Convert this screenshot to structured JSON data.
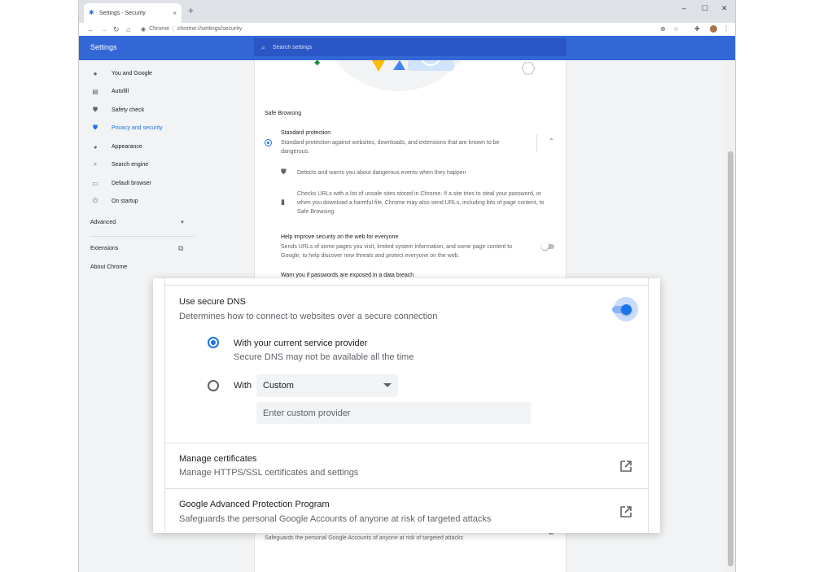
{
  "browser": {
    "tab_title": "Settings - Security",
    "tab_close": "×",
    "new_tab": "+",
    "win_min": "–",
    "win_max": "☐",
    "win_close": "✕",
    "omnibox_chip": "Chrome",
    "omnibox_url": "chrome://settings/security",
    "nav_back": "←",
    "nav_forward": "→",
    "nav_reload": "↻",
    "nav_home": "⌂"
  },
  "header": {
    "title": "Settings",
    "search_placeholder": "Search settings"
  },
  "sidebar": {
    "items": [
      {
        "label": "You and Google",
        "icon": "person-icon",
        "glyph": "●"
      },
      {
        "label": "Autofill",
        "icon": "clipboard-icon",
        "glyph": "▤"
      },
      {
        "label": "Safety check",
        "icon": "shield-check-icon",
        "glyph": "⛊"
      },
      {
        "label": "Privacy and security",
        "icon": "shield-icon",
        "glyph": "⛊"
      },
      {
        "label": "Appearance",
        "icon": "palette-icon",
        "glyph": "◕"
      },
      {
        "label": "Search engine",
        "icon": "search-icon",
        "glyph": "⌕"
      },
      {
        "label": "Default browser",
        "icon": "browser-icon",
        "glyph": "▭"
      },
      {
        "label": "On startup",
        "icon": "power-icon",
        "glyph": "⏻"
      }
    ],
    "advanced": "Advanced",
    "extensions": "Extensions",
    "about": "About Chrome"
  },
  "security": {
    "safe_browsing_label": "Safe Browsing",
    "standard": {
      "title": "Standard protection",
      "desc_line1": "Standard protection against websites, downloads, and extensions that are known to be",
      "desc_line2": "dangerous."
    },
    "detail1": "Detects and warns you about dangerous events when they happen",
    "detail2_lines": [
      "Checks URLs with a list of unsafe sites stored in Chrome. If a site tries to steal your password, or",
      "when you download a harmful file, Chrome may also send URLs, including bits of page content, to",
      "Safe Browsing."
    ],
    "help_improve": {
      "title": "Help improve security on the web for everyone",
      "desc_line1": "Sends URLs of some pages you visit, limited system information, and some page content to",
      "desc_line2": "Google, to help discover new threats and protect everyone on the web."
    },
    "warn_passwords": "Warn you if passwords are exposed in a data breach",
    "gapp_bottom_desc": "Safeguards the personal Google Accounts of anyone at risk of targeted attacks"
  },
  "zoom": {
    "dns_title": "Use secure DNS",
    "dns_desc": "Determines how to connect to websites over a secure connection",
    "opt1_title": "With your current service provider",
    "opt1_desc": "Secure DNS may not be available all the time",
    "opt2_label": "With",
    "select_value": "Custom",
    "custom_placeholder": "Enter custom provider",
    "certs_title": "Manage certificates",
    "certs_desc": "Manage HTTPS/SSL certificates and settings",
    "gapp_title": "Google Advanced Protection Program",
    "gapp_desc": "Safeguards the personal Google Accounts of anyone at risk of targeted attacks"
  },
  "colors": {
    "header_blue": "#3367d6",
    "accent": "#1a73e8",
    "content_bg": "#f1f3f4"
  }
}
